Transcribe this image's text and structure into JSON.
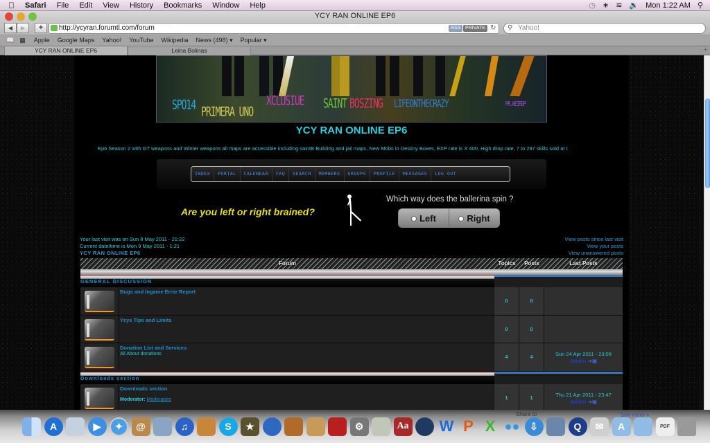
{
  "menubar": {
    "app": "Safari",
    "items": [
      "File",
      "Edit",
      "View",
      "History",
      "Bookmarks",
      "Window",
      "Help"
    ],
    "clock": "Mon 1:22 AM"
  },
  "window": {
    "title": "YCY RAN ONLINE EP6"
  },
  "toolbar": {
    "url": "http://ycyran.forumtl.com/forum",
    "rss_label": "RSS",
    "private_label": "PRIVATE",
    "search_placeholder": "Yahoo!"
  },
  "bookmarks": [
    "Apple",
    "Google Maps",
    "Yahoo!",
    "YouTube",
    "Wikipedia",
    "News (498) ▾",
    "Popular ▾"
  ],
  "tabs": [
    {
      "label": "YCY RAN ONLINE EP6",
      "active": true
    },
    {
      "label": "Leina Bolinas",
      "active": false
    }
  ],
  "banner": {
    "names": [
      {
        "text": "SPO14",
        "color": "#2aa7df"
      },
      {
        "text": "PRIMERA UNO",
        "color": "#d2c85c"
      },
      {
        "text": "XCLUSIUE",
        "color": "#d03ac0"
      },
      {
        "text": "SAINT",
        "color": "#6fc13a"
      },
      {
        "text": "BOSZING",
        "color": "#e0335c"
      },
      {
        "text": "LIFEONTHECRAZY",
        "color": "#2f7fd6"
      },
      {
        "text": "MR.WEIRDP",
        "color": "#9d3fd0"
      }
    ]
  },
  "site": {
    "title": "YCY RAN ONLINE EP6",
    "description": "Ep6 Season 2 with GT weapons and Winter weapons all maps are accessible including saintB Building and jail maps, New Mobs in Destiny Boxes, EXP rate is X 400, High drop rate, 7 to 297 skills sold at t"
  },
  "nav": [
    "INDEX",
    "PORTAL",
    "CALENDAR",
    "FAQ",
    "SEARCH",
    "MEMBERS",
    "GROUPS",
    "PROFILE",
    "MESSAGES",
    "LOG OUT"
  ],
  "quiz": {
    "question": "Are you left or right brained?",
    "prompt": "Which way does the ballerina spin ?",
    "left": "Left",
    "right": "Right"
  },
  "info": {
    "last_visit": "Your last visit was on Sun 8 May 2011 - 21:22",
    "current_time": "Current date/time is Mon 9 May 2011 - 1:21",
    "board_link": "YCY RAN ONLINE EP6",
    "links": [
      "View posts since last visit",
      "View your posts",
      "View unanswered posts"
    ]
  },
  "table": {
    "headers": {
      "forum": "Forum",
      "topics": "Topics",
      "posts": "Posts",
      "last": "Last Posts"
    },
    "categories": [
      {
        "title": "GENERAL DISCUSSION",
        "forums": [
          {
            "name": "Bugs and Ingame Error Report",
            "desc": "",
            "topics": "0",
            "posts": "0",
            "last_date": "",
            "last_user": ""
          },
          {
            "name": "Ycys Tips and Limits",
            "desc": "",
            "topics": "0",
            "posts": "0",
            "last_date": "",
            "last_user": ""
          },
          {
            "name": "Donation List and Services",
            "desc": "All About donations",
            "topics": "4",
            "posts": "4",
            "last_date": "Sun 24 Apr 2011 - 23:09",
            "last_user": "Admin"
          }
        ]
      },
      {
        "title": "Downloads section",
        "forums": [
          {
            "name": "Downloads section",
            "moderator_label": "Moderator:",
            "moderator": "Moderators",
            "topics": "1",
            "posts": "1",
            "last_date": "Thu 21 Apr 2011 - 23:47",
            "last_user": "Admin"
          }
        ]
      }
    ]
  },
  "dock": {
    "share_label": "Share to",
    "see_more": "See more »"
  }
}
